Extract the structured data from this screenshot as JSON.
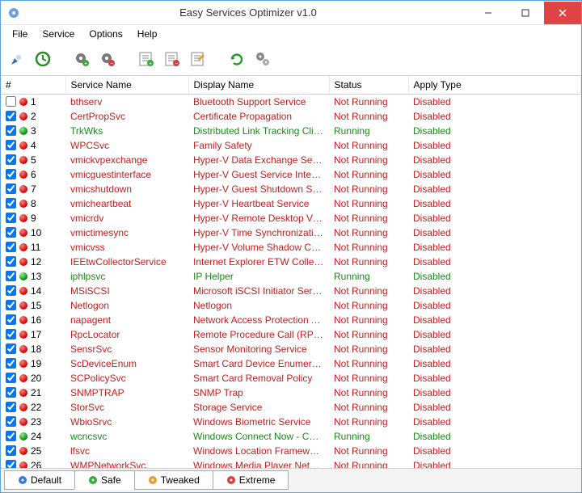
{
  "window": {
    "title": "Easy Services Optimizer v1.0"
  },
  "menu": {
    "file": "File",
    "service": "Service",
    "options": "Options",
    "help": "Help"
  },
  "columns": {
    "num": "#",
    "service_name": "Service Name",
    "display_name": "Display Name",
    "status": "Status",
    "apply_type": "Apply Type"
  },
  "rows": [
    {
      "n": 1,
      "checked": false,
      "running": false,
      "svc": "bthserv",
      "disp": "Bluetooth Support Service",
      "status": "Not Running",
      "apply": "Disabled"
    },
    {
      "n": 2,
      "checked": true,
      "running": false,
      "svc": "CertPropSvc",
      "disp": "Certificate Propagation",
      "status": "Not Running",
      "apply": "Disabled"
    },
    {
      "n": 3,
      "checked": true,
      "running": true,
      "svc": "TrkWks",
      "disp": "Distributed Link Tracking Client",
      "status": "Running",
      "apply": "Disabled"
    },
    {
      "n": 4,
      "checked": true,
      "running": false,
      "svc": "WPCSvc",
      "disp": "Family Safety",
      "status": "Not Running",
      "apply": "Disabled"
    },
    {
      "n": 5,
      "checked": true,
      "running": false,
      "svc": "vmickvpexchange",
      "disp": "Hyper-V Data Exchange Service",
      "status": "Not Running",
      "apply": "Disabled"
    },
    {
      "n": 6,
      "checked": true,
      "running": false,
      "svc": "vmicguestinterface",
      "disp": "Hyper-V Guest Service Interface",
      "status": "Not Running",
      "apply": "Disabled"
    },
    {
      "n": 7,
      "checked": true,
      "running": false,
      "svc": "vmicshutdown",
      "disp": "Hyper-V Guest Shutdown Service",
      "status": "Not Running",
      "apply": "Disabled"
    },
    {
      "n": 8,
      "checked": true,
      "running": false,
      "svc": "vmicheartbeat",
      "disp": "Hyper-V Heartbeat Service",
      "status": "Not Running",
      "apply": "Disabled"
    },
    {
      "n": 9,
      "checked": true,
      "running": false,
      "svc": "vmicrdv",
      "disp": "Hyper-V Remote Desktop Virtu...",
      "status": "Not Running",
      "apply": "Disabled"
    },
    {
      "n": 10,
      "checked": true,
      "running": false,
      "svc": "vmictimesync",
      "disp": "Hyper-V Time Synchronization ...",
      "status": "Not Running",
      "apply": "Disabled"
    },
    {
      "n": 11,
      "checked": true,
      "running": false,
      "svc": "vmicvss",
      "disp": "Hyper-V Volume Shadow Copy ...",
      "status": "Not Running",
      "apply": "Disabled"
    },
    {
      "n": 12,
      "checked": true,
      "running": false,
      "svc": "IEEtwCollectorService",
      "disp": "Internet Explorer ETW Collecto...",
      "status": "Not Running",
      "apply": "Disabled"
    },
    {
      "n": 13,
      "checked": true,
      "running": true,
      "svc": "iphlpsvc",
      "disp": "IP Helper",
      "status": "Running",
      "apply": "Disabled"
    },
    {
      "n": 14,
      "checked": true,
      "running": false,
      "svc": "MSiSCSI",
      "disp": "Microsoft iSCSI Initiator Service",
      "status": "Not Running",
      "apply": "Disabled"
    },
    {
      "n": 15,
      "checked": true,
      "running": false,
      "svc": "Netlogon",
      "disp": "Netlogon",
      "status": "Not Running",
      "apply": "Disabled"
    },
    {
      "n": 16,
      "checked": true,
      "running": false,
      "svc": "napagent",
      "disp": "Network Access Protection Agent",
      "status": "Not Running",
      "apply": "Disabled"
    },
    {
      "n": 17,
      "checked": true,
      "running": false,
      "svc": "RpcLocator",
      "disp": "Remote Procedure Call (RPC) L...",
      "status": "Not Running",
      "apply": "Disabled"
    },
    {
      "n": 18,
      "checked": true,
      "running": false,
      "svc": "SensrSvc",
      "disp": "Sensor Monitoring Service",
      "status": "Not Running",
      "apply": "Disabled"
    },
    {
      "n": 19,
      "checked": true,
      "running": false,
      "svc": "ScDeviceEnum",
      "disp": "Smart Card Device Enumeratio...",
      "status": "Not Running",
      "apply": "Disabled"
    },
    {
      "n": 20,
      "checked": true,
      "running": false,
      "svc": "SCPolicySvc",
      "disp": "Smart Card Removal Policy",
      "status": "Not Running",
      "apply": "Disabled"
    },
    {
      "n": 21,
      "checked": true,
      "running": false,
      "svc": "SNMPTRAP",
      "disp": "SNMP Trap",
      "status": "Not Running",
      "apply": "Disabled"
    },
    {
      "n": 22,
      "checked": true,
      "running": false,
      "svc": "StorSvc",
      "disp": "Storage Service",
      "status": "Not Running",
      "apply": "Disabled"
    },
    {
      "n": 23,
      "checked": true,
      "running": false,
      "svc": "WbioSrvc",
      "disp": "Windows Biometric Service",
      "status": "Not Running",
      "apply": "Disabled"
    },
    {
      "n": 24,
      "checked": true,
      "running": true,
      "svc": "wcncsvc",
      "disp": "Windows Connect Now - Config...",
      "status": "Running",
      "apply": "Disabled"
    },
    {
      "n": 25,
      "checked": true,
      "running": false,
      "svc": "lfsvc",
      "disp": "Windows Location Framework S...",
      "status": "Not Running",
      "apply": "Disabled"
    },
    {
      "n": 26,
      "checked": true,
      "running": false,
      "svc": "WMPNetworkSvc",
      "disp": "Windows Media Player Network...",
      "status": "Not Running",
      "apply": "Disabled"
    }
  ],
  "tabs": {
    "default": "Default",
    "safe": "Safe",
    "tweaked": "Tweaked",
    "extreme": "Extreme",
    "active": "safe"
  },
  "colors": {
    "running": "#1a8a1a",
    "not_running": "#c02020"
  }
}
